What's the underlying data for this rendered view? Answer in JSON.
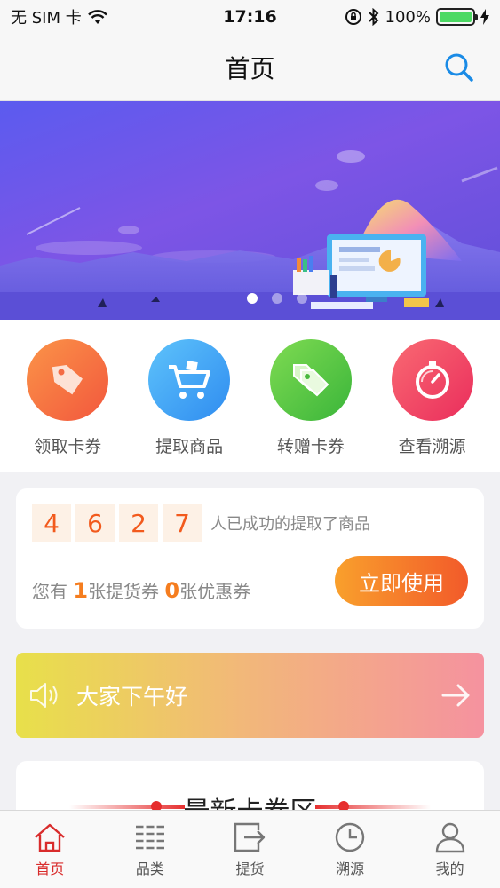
{
  "status_bar": {
    "carrier": "无 SIM 卡",
    "time": "17:16",
    "battery": "100%"
  },
  "nav": {
    "title": "首页"
  },
  "banner": {
    "slide_count": 3,
    "active_index": 0
  },
  "quick_actions": [
    {
      "label": "领取卡券",
      "icon": "tag-icon",
      "color": "#f46b45"
    },
    {
      "label": "提取商品",
      "icon": "cart-icon",
      "color": "#2f9bf4"
    },
    {
      "label": "转赠卡券",
      "icon": "tags-icon",
      "color": "#55c640"
    },
    {
      "label": "查看溯源",
      "icon": "stopwatch-icon",
      "color": "#f23b5c"
    }
  ],
  "stats": {
    "digits": [
      "4",
      "6",
      "2",
      "7"
    ],
    "caption": "人已成功的提取了商品",
    "coupon_prefix": "您有",
    "pickup_count": "1",
    "pickup_text": "张提货券",
    "discount_count": "0",
    "discount_text": "张优惠券",
    "use_button": "立即使用"
  },
  "greeting": {
    "text": "大家下午好"
  },
  "newest": {
    "title": "最新卡券区"
  },
  "tabs": [
    {
      "label": "首页",
      "icon": "home-icon",
      "active": true
    },
    {
      "label": "品类",
      "icon": "category-icon",
      "active": false
    },
    {
      "label": "提货",
      "icon": "pickup-icon",
      "active": false
    },
    {
      "label": "溯源",
      "icon": "clock-icon",
      "active": false
    },
    {
      "label": "我的",
      "icon": "user-icon",
      "active": false
    }
  ]
}
